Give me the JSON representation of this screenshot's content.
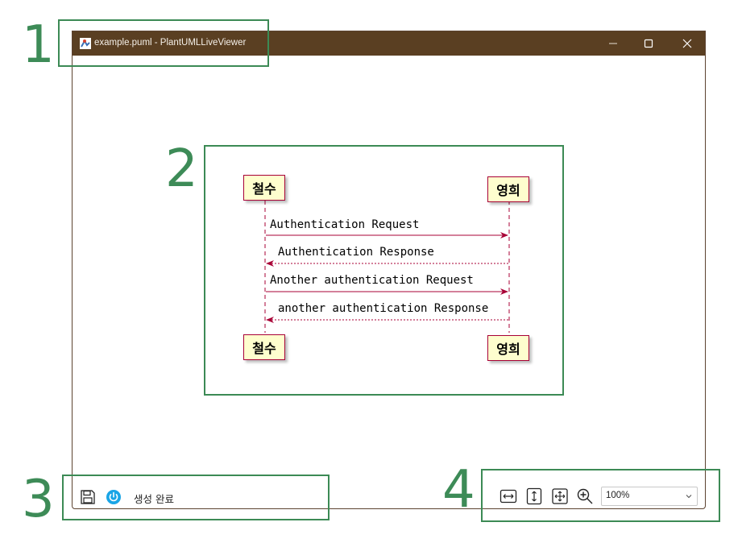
{
  "window": {
    "title": "example.puml - PlantUMLLiveViewer",
    "controls": [
      "minimize",
      "maximize",
      "close"
    ]
  },
  "diagram": {
    "participants": [
      {
        "name": "철수"
      },
      {
        "name": "영희"
      }
    ],
    "messages": [
      {
        "from": "철수",
        "to": "영희",
        "label": "Authentication Request",
        "style": "solid"
      },
      {
        "from": "영희",
        "to": "철수",
        "label": "Authentication Response",
        "style": "dashed"
      },
      {
        "from": "철수",
        "to": "영희",
        "label": "Another authentication Request",
        "style": "solid"
      },
      {
        "from": "영희",
        "to": "철수",
        "label": "another authentication Response",
        "style": "dashed"
      }
    ],
    "colors": {
      "arrow": "#a80036",
      "participant_fill": "#fefece",
      "participant_border": "#a80036"
    }
  },
  "statusbar": {
    "icons": [
      "save-icon",
      "power-icon"
    ],
    "status_text": "생성 완료"
  },
  "toolbar": {
    "buttons": [
      "fit-width-icon",
      "fit-height-icon",
      "fit-all-icon",
      "zoom-in-icon"
    ],
    "zoom": {
      "selected": "100%"
    }
  },
  "annotations": {
    "labels": [
      "1",
      "2",
      "3",
      "4"
    ],
    "color": "#3c8a55"
  }
}
